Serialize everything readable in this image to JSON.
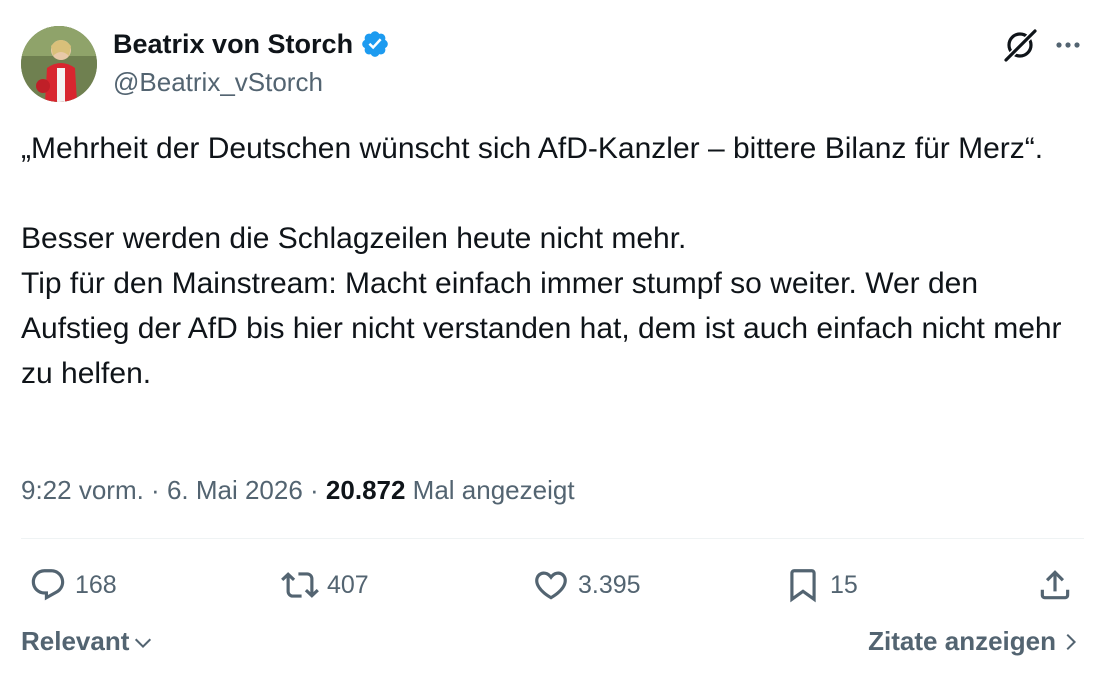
{
  "author": {
    "name": "Beatrix von Storch",
    "handle": "@Beatrix_vStorch",
    "verified_icon": "verified-badge-icon",
    "verified_color": "#1d9bf0"
  },
  "tweet": {
    "line1": "„Mehrheit der Deutschen wünscht sich AfD-Kanzler – bittere Bilanz für Merz“.",
    "line2": "Besser werden die Schlagzeilen heute nicht mehr.",
    "line3": "Tip für den Mainstream: Macht einfach immer stumpf so weiter. Wer den Aufstieg der AfD bis hier nicht verstanden hat, dem ist auch einfach nicht mehr zu helfen."
  },
  "meta": {
    "time": "9:22 vorm.",
    "sep1": " · ",
    "date": "6. Mai 2026",
    "sep2": " · ",
    "views": "20.872",
    "views_label": " Mal angezeigt"
  },
  "actions": {
    "replies": "168",
    "reposts": "407",
    "likes": "3.395",
    "bookmarks": "15"
  },
  "footer": {
    "sort_label": "Relevant",
    "quotes_label": "Zitate anzeigen"
  },
  "colors": {
    "text": "#0f1419",
    "secondary": "#536471",
    "divider": "#eff3f4"
  }
}
